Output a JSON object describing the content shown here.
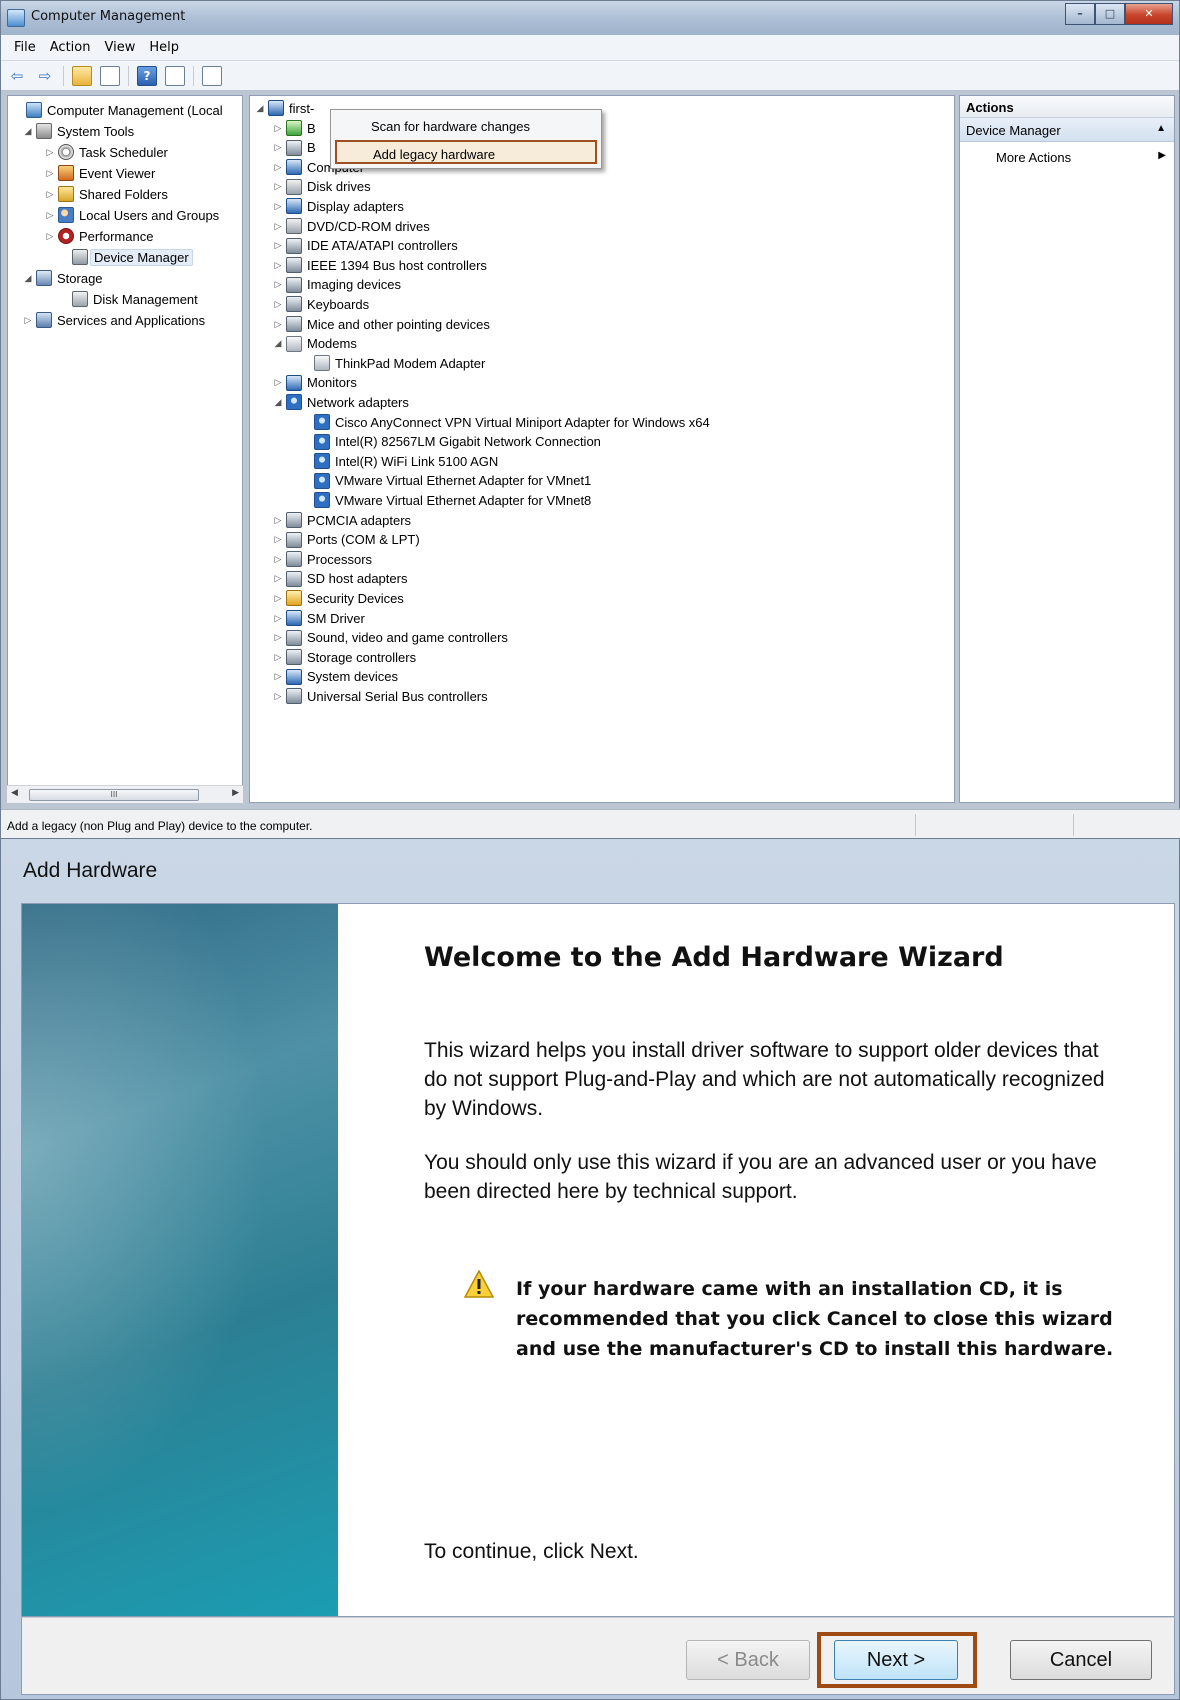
{
  "cm": {
    "title": "Computer Management",
    "menu": [
      "File",
      "Action",
      "View",
      "Help"
    ],
    "left_tree": [
      {
        "label": "Computer Management (Local",
        "icon": "computer-management-icon"
      },
      {
        "label": "System Tools",
        "icon": "tools-icon"
      },
      {
        "label": "Task Scheduler",
        "icon": "clock-icon"
      },
      {
        "label": "Event Viewer",
        "icon": "event-viewer-icon"
      },
      {
        "label": "Shared Folders",
        "icon": "shared-folder-icon"
      },
      {
        "label": "Local Users and Groups",
        "icon": "users-icon"
      },
      {
        "label": "Performance",
        "icon": "performance-icon"
      },
      {
        "label": "Device Manager",
        "icon": "device-manager-icon"
      },
      {
        "label": "Storage",
        "icon": "storage-icon"
      },
      {
        "label": "Disk Management",
        "icon": "disk-icon"
      },
      {
        "label": "Services and Applications",
        "icon": "services-icon"
      }
    ],
    "root_node": "first-",
    "devices": [
      "B",
      "B",
      "Computer",
      "Disk drives",
      "Display adapters",
      "DVD/CD-ROM drives",
      "IDE ATA/ATAPI controllers",
      "IEEE 1394 Bus host controllers",
      "Imaging devices",
      "Keyboards",
      "Mice and other pointing devices",
      "Modems",
      "ThinkPad Modem Adapter",
      "Monitors",
      "Network adapters",
      "Cisco AnyConnect VPN Virtual Miniport Adapter for Windows x64",
      "Intel(R) 82567LM Gigabit Network Connection",
      "Intel(R) WiFi Link 5100 AGN",
      "VMware Virtual Ethernet Adapter for VMnet1",
      "VMware Virtual Ethernet Adapter for VMnet8",
      "PCMCIA adapters",
      "Ports (COM & LPT)",
      "Processors",
      "SD host adapters",
      "Security Devices",
      "SM Driver",
      "Sound, video and game controllers",
      "Storage controllers",
      "System devices",
      "Universal Serial Bus controllers"
    ],
    "context_menu": [
      "Scan for hardware changes",
      "Add legacy hardware"
    ],
    "actions": {
      "header": "Actions",
      "section": "Device Manager",
      "more": "More Actions"
    },
    "scroll_thumb": "III",
    "status": "Add a legacy (non Plug and Play) device to the computer."
  },
  "wizard": {
    "title": "Add Hardware",
    "heading": "Welcome to the Add Hardware Wizard",
    "para1": "This wizard helps you install driver software to support older devices that do not support Plug-and-Play and which are not automatically recognized by Windows.",
    "para2": "You should only use this wizard if you are an advanced user or you have been directed here by technical support.",
    "warning": "If your hardware came with an installation CD, it is recommended that you click Cancel to close this wizard and use the manufacturer's CD to install this hardware.",
    "continue": "To continue, click Next.",
    "back_label": "< Back",
    "next_label": "Next >",
    "cancel_label": "Cancel"
  }
}
